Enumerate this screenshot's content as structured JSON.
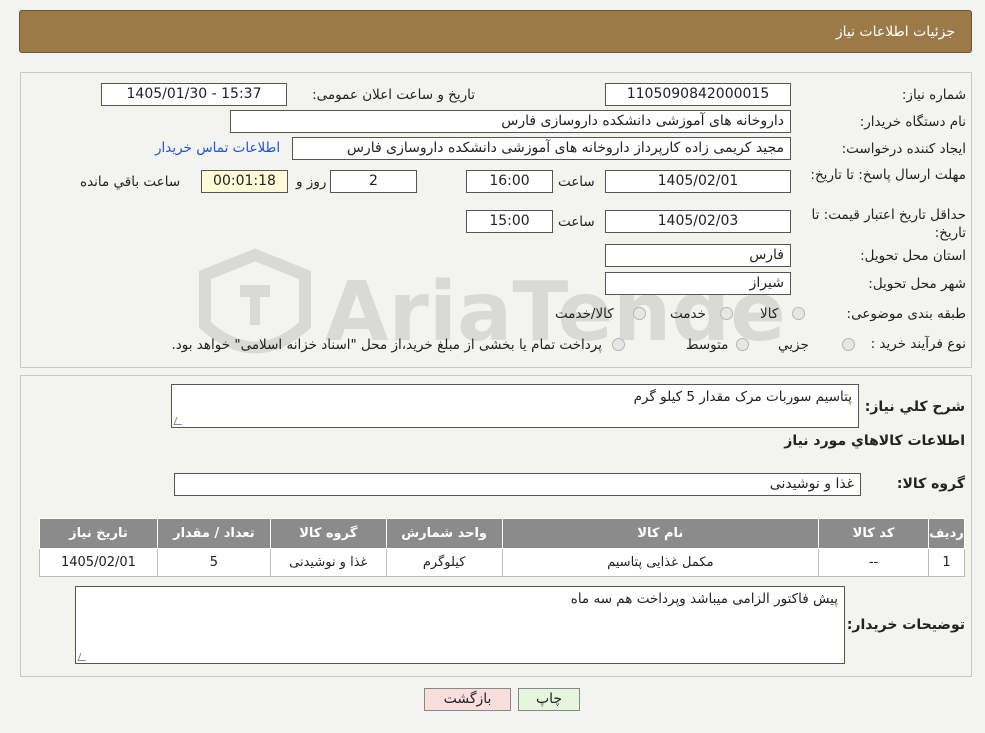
{
  "header": {
    "title": "جزئیات اطلاعات نیاز"
  },
  "fields": {
    "need_number_label": "شماره نیاز:",
    "need_number": "1105090842000015",
    "announce_label": "تاریخ و ساعت اعلان عمومی:",
    "announce_value": "1405/01/30 - 15:37",
    "buyer_org_label": "نام دستگاه خریدار:",
    "buyer_org": "داروخانه های آموزشی دانشکده داروسازی فارس",
    "creator_label": "ایجاد کننده درخواست:",
    "creator": "مجید کریمی زاده کارپرداز داروخانه های آموزشی دانشکده داروسازی فارس",
    "contact_link": "اطلاعات تماس خریدار",
    "deadline_label": "مهلت ارسال پاسخ: تا تاریخ:",
    "deadline_date": "1405/02/01",
    "time_label": "ساعت",
    "deadline_time": "16:00",
    "days_value": "2",
    "days_label": "روز و",
    "remaining_time": "00:01:18",
    "remaining_label": "ساعت باقي مانده",
    "validity_label": "حداقل تاریخ اعتبار قیمت: تا تاریخ:",
    "validity_date": "1405/02/03",
    "validity_time": "15:00",
    "province_label": "استان محل تحویل:",
    "province": "فارس",
    "city_label": "شهر محل تحویل:",
    "city": "شیراز",
    "category_label": "طبقه بندی موضوعی:",
    "category_options": [
      "کالا",
      "خدمت",
      "کالا/خدمت"
    ],
    "process_label": "نوع فرآیند خرید :",
    "process_options": [
      "جزیي",
      "متوسط"
    ],
    "process_note": "پرداخت تمام یا بخشی از مبلغ خرید،از محل \"اسناد خزانه اسلامی\" خواهد بود."
  },
  "description": {
    "label": "شرح کلي نياز:",
    "value": "پتاسیم سوربات مرک  مقدار 5 کیلو گرم"
  },
  "goods_section_title": "اطلاعات كالاهاي مورد نياز",
  "goods_group": {
    "label": "گروه کالا:",
    "value": "غذا و نوشیدنی"
  },
  "table": {
    "headers": [
      "رديف",
      "كد كالا",
      "نام كالا",
      "واحد شمارش",
      "گروه كالا",
      "تعداد / مقدار",
      "تاريخ نياز"
    ],
    "rows": [
      [
        "1",
        "--",
        "مکمل غذایی پتاسیم",
        "کیلوگرم",
        "غذا و نوشیدنی",
        "5",
        "1405/02/01"
      ]
    ]
  },
  "buyer_notes": {
    "label": "توضیحات خریدار:",
    "value": "پیش فاکتور الزامی میباشد وپرداخت هم سه ماه"
  },
  "buttons": {
    "print": "چاپ",
    "back": "بازگشت"
  },
  "watermark": {
    "text": "AriaTender.neT"
  },
  "colors": {
    "header": "#9b7a48",
    "table_header": "#8b8b8b",
    "link": "#2255cc",
    "back_button": "#f9dede",
    "print_button": "#e6f5dd"
  }
}
